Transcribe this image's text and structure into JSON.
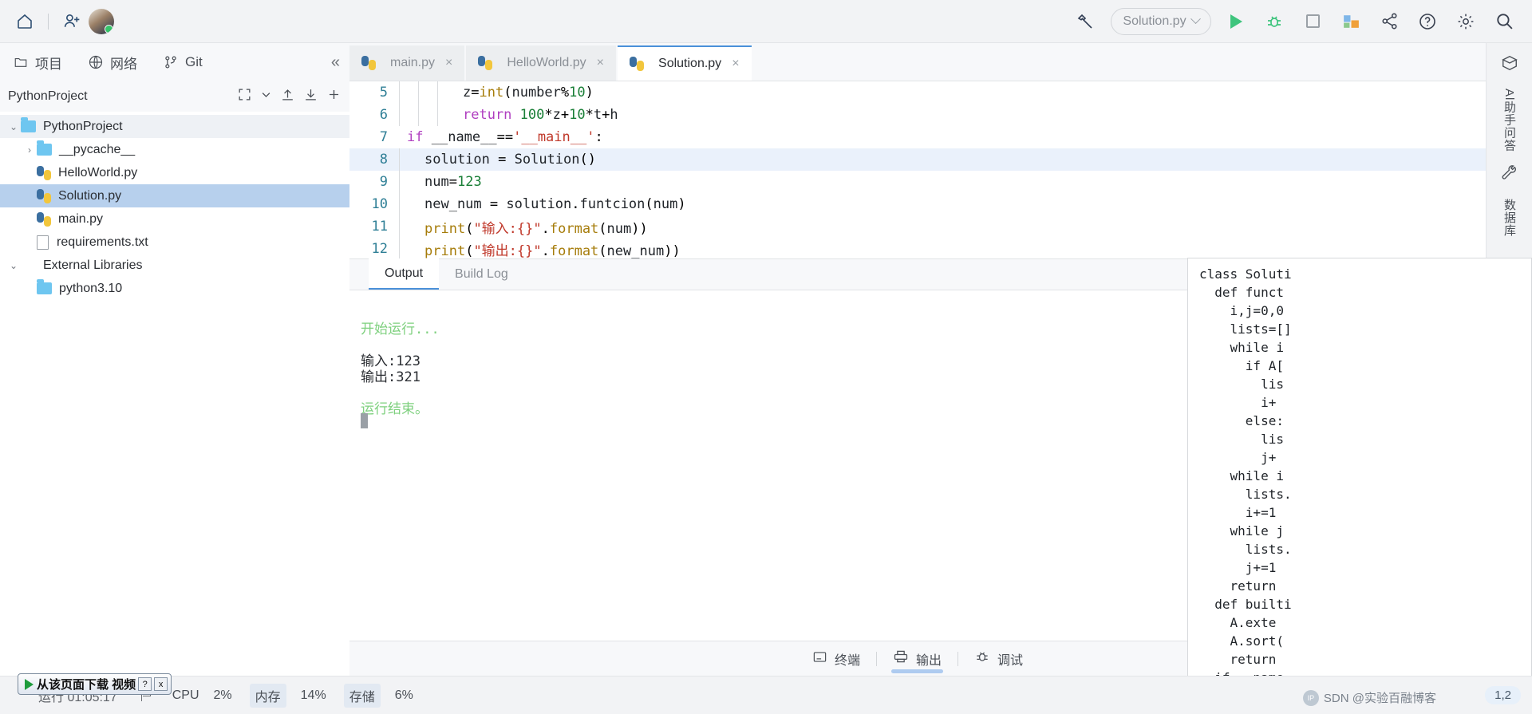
{
  "toolbar": {
    "home_icon": "home-icon",
    "add_user_icon": "add-user-icon",
    "avatar": "avatar",
    "build_icon": "hammer-icon",
    "run_config": "Solution.py",
    "run_icon": "run-icon",
    "debug_icon": "debug-icon",
    "stop_icon": "stop-icon",
    "plugin_icon": "plugin-icon",
    "share_icon": "share-icon",
    "help_icon": "help-icon",
    "settings_icon": "settings-icon",
    "search_icon": "search-icon"
  },
  "sidebar": {
    "tabs": [
      {
        "label": "项目",
        "icon": "folder-icon"
      },
      {
        "label": "网络",
        "icon": "globe-icon"
      },
      {
        "label": "Git",
        "icon": "git-branch-icon"
      }
    ],
    "collapse_icon": "collapse-left-icon",
    "panel_title": "PythonProject",
    "tools": {
      "expand": "expand-icon",
      "dropdown": "chevron-down-icon",
      "upload": "upload-icon",
      "download": "download-icon",
      "add": "plus-icon"
    },
    "tree": [
      {
        "label": "PythonProject",
        "type": "folder",
        "depth": 0,
        "expanded": true,
        "selected": false,
        "highlight": true
      },
      {
        "label": "__pycache__",
        "type": "folder",
        "depth": 1,
        "expanded": false,
        "selected": false,
        "highlight": false
      },
      {
        "label": "HelloWorld.py",
        "type": "python",
        "depth": 1,
        "selected": false,
        "highlight": false
      },
      {
        "label": "Solution.py",
        "type": "python",
        "depth": 1,
        "selected": true,
        "highlight": false
      },
      {
        "label": "main.py",
        "type": "python",
        "depth": 1,
        "selected": false,
        "highlight": false
      },
      {
        "label": "requirements.txt",
        "type": "text",
        "depth": 1,
        "selected": false,
        "highlight": false
      },
      {
        "label": "External Libraries",
        "type": "lib",
        "depth": 0,
        "expanded": true,
        "selected": false,
        "highlight": false
      },
      {
        "label": "python3.10",
        "type": "folder",
        "depth": 1,
        "selected": false,
        "highlight": false
      }
    ]
  },
  "editor": {
    "tabs": [
      {
        "label": "main.py",
        "active": false
      },
      {
        "label": "HelloWorld.py",
        "active": false
      },
      {
        "label": "Solution.py",
        "active": true
      }
    ],
    "close_icon": "close-icon",
    "lines": [
      {
        "no": "5",
        "indent": 3,
        "current": false,
        "code": "z=int(number%10)"
      },
      {
        "no": "6",
        "indent": 3,
        "current": false,
        "code": "return 100*z+10*t+h"
      },
      {
        "no": "7",
        "indent": 0,
        "current": false,
        "code": "if __name__=='__main__':"
      },
      {
        "no": "8",
        "indent": 1,
        "current": true,
        "code": "solution = Solution()"
      },
      {
        "no": "9",
        "indent": 1,
        "current": false,
        "code": "num=123"
      },
      {
        "no": "10",
        "indent": 1,
        "current": false,
        "code": "new_num = solution.funtcion(num)"
      },
      {
        "no": "11",
        "indent": 1,
        "current": false,
        "code": "print(\"输入:{}\".format(num))"
      },
      {
        "no": "12",
        "indent": 1,
        "current": false,
        "code": "print(\"输出:{}\".format(new_num))"
      }
    ]
  },
  "output_panel": {
    "tabs": [
      {
        "label": "Output",
        "active": true
      },
      {
        "label": "Build Log",
        "active": false
      }
    ],
    "lines": [
      {
        "text": "开始运行...",
        "style": "green"
      },
      {
        "text": "",
        "style": "plain"
      },
      {
        "text": "输入:123",
        "style": "plain"
      },
      {
        "text": "输出:321",
        "style": "plain"
      },
      {
        "text": "",
        "style": "plain"
      },
      {
        "text": "运行结束。",
        "style": "green"
      }
    ]
  },
  "bottom_tools": [
    {
      "label": "终端",
      "icon": "terminal-icon",
      "active": false
    },
    {
      "label": "输出",
      "icon": "output-printer-icon",
      "active": true
    },
    {
      "label": "调试",
      "icon": "debug-bug-icon",
      "active": false
    }
  ],
  "right_rail": {
    "icons": [
      "plugin-box-icon",
      "wrench-icon"
    ],
    "labels": [
      "Al助手问答",
      "数据库"
    ]
  },
  "overlay_code": "class Soluti\n  def funct\n    i,j=0,0\n    lists=[]\n    while i\n      if A[\n        lis\n        i+\n      else:\n        lis\n        j+\n    while i\n      lists.\n      i+=1\n    while j\n      lists.\n      j+=1\n    return\n  def builti\n    A.exte\n    A.sort(\n    return\n  if __name",
  "status_bar": {
    "run_time": "运行 01:05:17",
    "flag_icon": "flag-icon",
    "metrics": [
      {
        "label": "CPU",
        "value": "2%"
      },
      {
        "label": "内存",
        "value": "14%"
      },
      {
        "label": "存储",
        "value": "6%"
      }
    ],
    "position": "1,2",
    "download_popup": {
      "text": "从该页面下载 视频",
      "help": "?",
      "close": "x"
    },
    "watermark": "SDN @实验百融博客"
  }
}
